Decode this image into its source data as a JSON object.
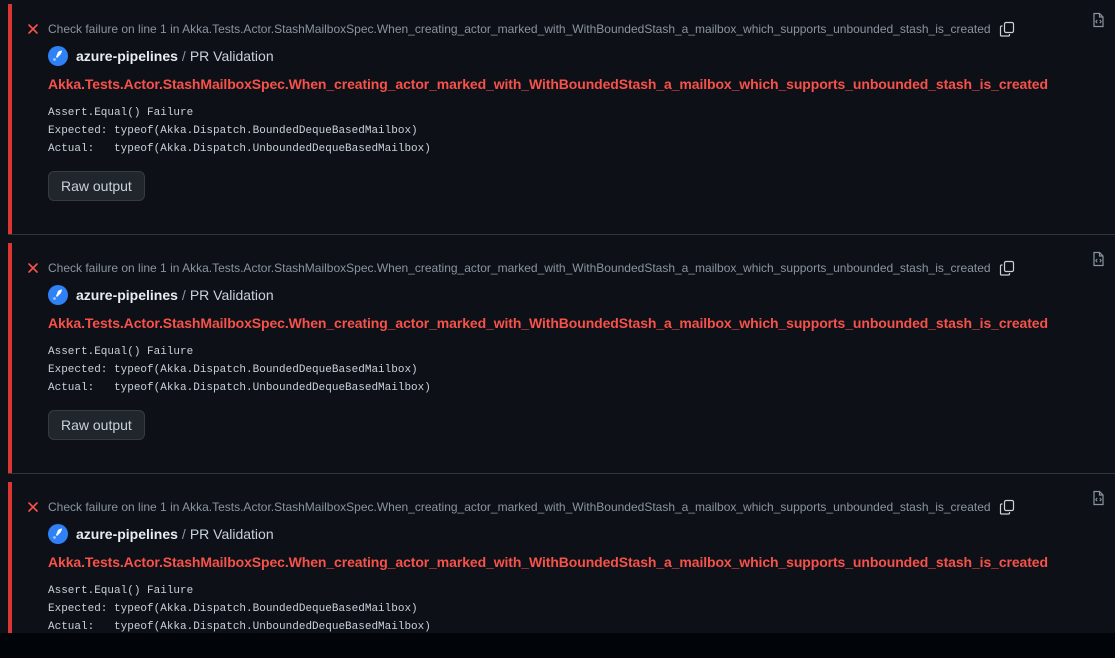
{
  "annotations": [
    {
      "header": "Check failure on line 1 in Akka.Tests.Actor.StashMailboxSpec.When_creating_actor_marked_with_WithBoundedStash_a_mailbox_which_supports_unbounded_stash_is_created",
      "app_name": "azure-pipelines",
      "separator": "/",
      "check_name": "PR Validation",
      "title": "Akka.Tests.Actor.StashMailboxSpec.When_creating_actor_marked_with_WithBoundedStash_a_mailbox_which_supports_unbounded_stash_is_created",
      "message": "Assert.Equal() Failure\nExpected: typeof(Akka.Dispatch.BoundedDequeBasedMailbox)\nActual:   typeof(Akka.Dispatch.UnboundedDequeBasedMailbox)",
      "raw_output_label": "Raw output"
    },
    {
      "header": "Check failure on line 1 in Akka.Tests.Actor.StashMailboxSpec.When_creating_actor_marked_with_WithBoundedStash_a_mailbox_which_supports_unbounded_stash_is_created",
      "app_name": "azure-pipelines",
      "separator": "/",
      "check_name": "PR Validation",
      "title": "Akka.Tests.Actor.StashMailboxSpec.When_creating_actor_marked_with_WithBoundedStash_a_mailbox_which_supports_unbounded_stash_is_created",
      "message": "Assert.Equal() Failure\nExpected: typeof(Akka.Dispatch.BoundedDequeBasedMailbox)\nActual:   typeof(Akka.Dispatch.UnboundedDequeBasedMailbox)",
      "raw_output_label": "Raw output"
    },
    {
      "header": "Check failure on line 1 in Akka.Tests.Actor.StashMailboxSpec.When_creating_actor_marked_with_WithBoundedStash_a_mailbox_which_supports_unbounded_stash_is_created",
      "app_name": "azure-pipelines",
      "separator": "/",
      "check_name": "PR Validation",
      "title": "Akka.Tests.Actor.StashMailboxSpec.When_creating_actor_marked_with_WithBoundedStash_a_mailbox_which_supports_unbounded_stash_is_created",
      "message": "Assert.Equal() Failure\nExpected: typeof(Akka.Dispatch.BoundedDequeBasedMailbox)\nActual:   typeof(Akka.Dispatch.UnboundedDequeBasedMailbox)"
    }
  ],
  "icons": {
    "failure": "x-icon",
    "copy": "copy-icon",
    "raw_file": "file-code-icon",
    "app": "azure-pipelines-logo"
  },
  "colors": {
    "background": "#0d1117",
    "failure_accent": "#da3633",
    "failure_title": "#f85149",
    "muted_text": "#8b949e",
    "button_bg": "#21262d"
  }
}
